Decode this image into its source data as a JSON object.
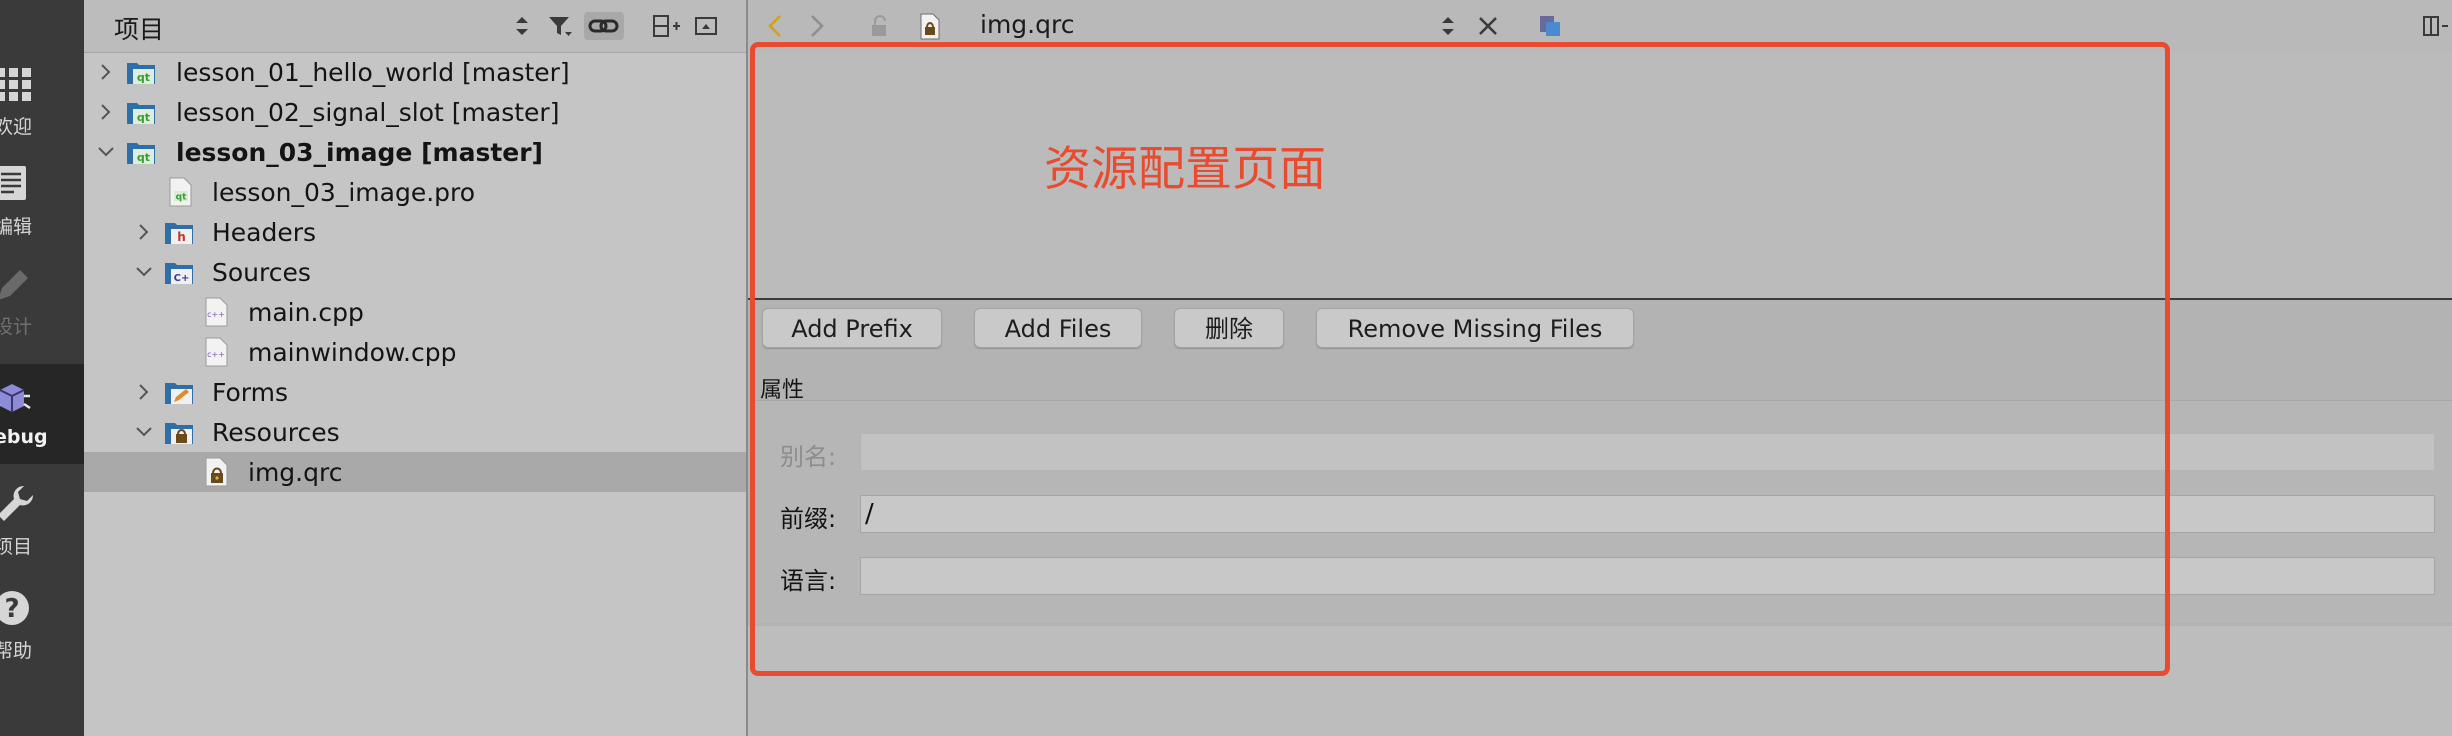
{
  "modes": [
    {
      "label": "欢迎",
      "icon": "grid-icon",
      "state": "normal"
    },
    {
      "label": "编辑",
      "icon": "edit-document-icon",
      "state": "normal"
    },
    {
      "label": "设计",
      "icon": "pencil-icon",
      "state": "disabled"
    },
    {
      "label": "ebug",
      "icon": "bug-icon",
      "state": "active"
    },
    {
      "label": "项目",
      "icon": "wrench-icon",
      "state": "normal"
    },
    {
      "label": "帮助",
      "icon": "help-icon",
      "state": "normal"
    }
  ],
  "project_panel": {
    "title": "项目",
    "tree": [
      {
        "label": "lesson_01_hello_world [master]",
        "icon": "qt-project-folder-icon",
        "expanded": false
      },
      {
        "label": "lesson_02_signal_slot [master]",
        "icon": "qt-project-folder-icon",
        "expanded": false
      },
      {
        "label": "lesson_03_image [master]",
        "icon": "qt-project-folder-icon",
        "expanded": true
      },
      {
        "label": "lesson_03_image.pro",
        "icon": "pro-file-icon"
      },
      {
        "label": "Headers",
        "icon": "headers-folder-icon",
        "expanded": false
      },
      {
        "label": "Sources",
        "icon": "sources-folder-icon",
        "expanded": true
      },
      {
        "label": "main.cpp",
        "icon": "cpp-file-icon"
      },
      {
        "label": "mainwindow.cpp",
        "icon": "cpp-file-icon"
      },
      {
        "label": "Forms",
        "icon": "forms-folder-icon",
        "expanded": false
      },
      {
        "label": "Resources",
        "icon": "resources-folder-icon",
        "expanded": true
      },
      {
        "label": "img.qrc",
        "icon": "qrc-file-icon",
        "selected": true
      }
    ]
  },
  "editor": {
    "document_name": "img.qrc",
    "annotation_text": "资源配置页面",
    "buttons": {
      "add_prefix": "Add Prefix",
      "add_files": "Add Files",
      "delete": "删除",
      "remove_missing": "Remove Missing Files"
    },
    "properties": {
      "title": "属性",
      "alias_label": "别名:",
      "alias_value": "",
      "prefix_label": "前缀:",
      "prefix_value": "/",
      "language_label": "语言:",
      "language_value": ""
    }
  },
  "colors": {
    "annotation": "#e84b2f",
    "modebar": "#3a3a3a",
    "selection": "#a9a9a9"
  }
}
